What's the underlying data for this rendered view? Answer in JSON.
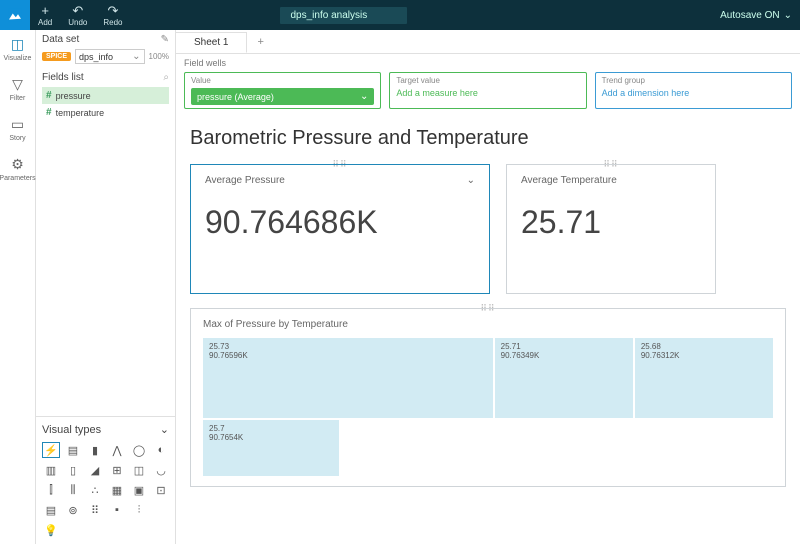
{
  "topbar": {
    "add": "Add",
    "undo": "Undo",
    "redo": "Redo",
    "title": "dps_info analysis",
    "autosave": "Autosave ON"
  },
  "rail": [
    {
      "label": "Visualize"
    },
    {
      "label": "Filter"
    },
    {
      "label": "Story"
    },
    {
      "label": "Parameters"
    }
  ],
  "dataset": {
    "header": "Data set",
    "badge": "SPICE",
    "name": "dps_info",
    "pct": "100%"
  },
  "fields": {
    "header": "Fields list",
    "items": [
      {
        "name": "pressure",
        "sel": true
      },
      {
        "name": "temperature",
        "sel": false
      }
    ]
  },
  "visualtypes": {
    "header": "Visual types"
  },
  "tabs": {
    "sheet": "Sheet 1"
  },
  "fieldwells": {
    "label": "Field wells",
    "value": {
      "title": "Value",
      "chip": "pressure (Average)"
    },
    "target": {
      "title": "Target value",
      "placeholder": "Add a measure here"
    },
    "trend": {
      "title": "Trend group",
      "placeholder": "Add a dimension here"
    }
  },
  "dash": {
    "title": "Barometric Pressure and Temperature",
    "kpi1": {
      "label": "Average Pressure",
      "value": "90.764686K"
    },
    "kpi2": {
      "label": "Average Temperature",
      "value": "25.71"
    },
    "tree": {
      "title": "Max of Pressure by Temperature",
      "cells": [
        {
          "t": "25.73",
          "v": "90.76596K"
        },
        {
          "t": "25.71",
          "v": "90.76349K"
        },
        {
          "t": "25.68",
          "v": "90.76312K"
        },
        {
          "t": "25.7",
          "v": "90.7654K"
        }
      ]
    }
  },
  "chart_data": {
    "type": "table",
    "title": "Max of Pressure by Temperature",
    "series": [
      {
        "name": "temperature",
        "values": [
          25.73,
          25.71,
          25.68,
          25.7
        ]
      },
      {
        "name": "max_pressure",
        "values": [
          90765.96,
          90763.49,
          90763.12,
          90765.4
        ]
      }
    ]
  }
}
